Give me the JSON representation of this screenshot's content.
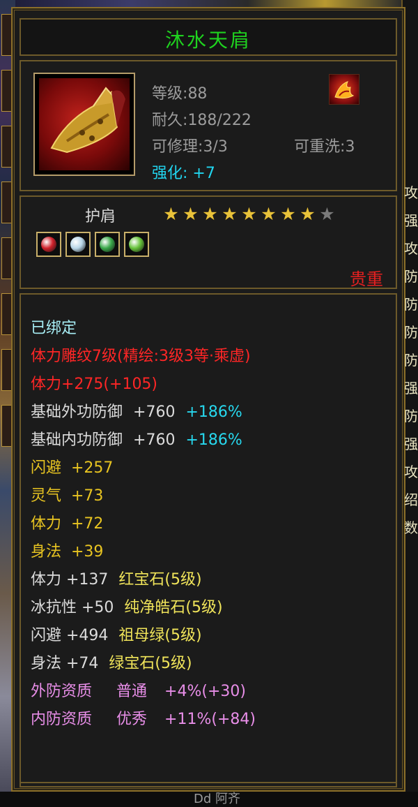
{
  "item": {
    "name": "沐水天肩",
    "level_label": "等级",
    "level": "88",
    "durability_label": "耐久",
    "durability": "188/222",
    "repairable_label": "可修理",
    "repairable": "3/3",
    "rewash_label": "可重洗",
    "rewash": "3",
    "enhance_label": "强化:",
    "enhance": "+7",
    "slot": "护肩",
    "stars_total": 9,
    "stars_on": 8,
    "rarity": "贵重",
    "gems": [
      {
        "icon": "ruby-gem-icon",
        "color": "#d0212b"
      },
      {
        "icon": "diamond-gem-icon",
        "color": "#b9d6e8"
      },
      {
        "icon": "jade-gem-icon",
        "color": "#3aa84a"
      },
      {
        "icon": "emerald-gem-icon",
        "color": "#66c23a"
      }
    ]
  },
  "attributes": {
    "bound": "已绑定",
    "engrave": "体力雕纹7级(精绘:3级3等·乘虚)",
    "vit_total": "体力+275(+105)",
    "outer_def_label": "基础外功防御",
    "outer_def_val": "+760",
    "outer_def_pct": "+186%",
    "inner_def_label": "基础内功防御",
    "inner_def_val": "+760",
    "inner_def_pct": "+186%",
    "dodge": "闪避  +257",
    "spirit": "灵气  +73",
    "vit": "体力  +72",
    "agility": "身法  +39",
    "gem1_stat": "体力 +137",
    "gem1_name": "红宝石(5级)",
    "gem2_stat": "冰抗性 +50",
    "gem2_name": "纯净皓石(5级)",
    "gem3_stat": "闪避 +494",
    "gem3_name": "祖母绿(5级)",
    "gem4_stat": "身法 +74",
    "gem4_name": "绿宝石(5级)",
    "outer_quality_label": "外防资质",
    "outer_quality_grade": "普通",
    "outer_quality_val": "+4%(+30)",
    "inner_quality_label": "内防资质",
    "inner_quality_grade": "优秀",
    "inner_quality_val": "+11%(+84)"
  },
  "colors": {
    "name": "#1fd21f",
    "rarity": "#e52020",
    "enhance": "#21d6f0"
  },
  "footer": {
    "text": "Dd  阿齐"
  },
  "background": {
    "right_chars": [
      "攻",
      "强",
      "攻",
      "防",
      "防",
      "防",
      "防",
      "强",
      "防",
      "强",
      "攻",
      "绍",
      "数"
    ]
  }
}
